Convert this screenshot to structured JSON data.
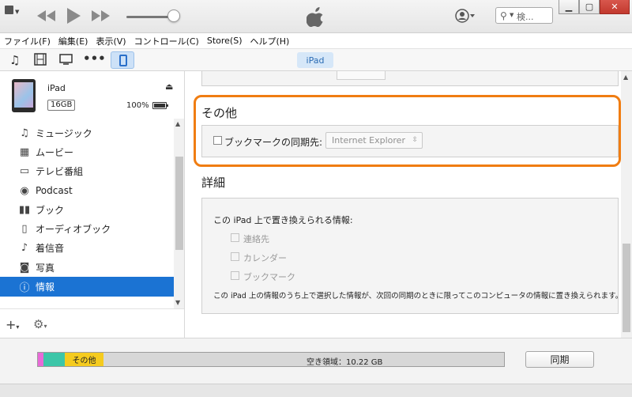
{
  "titlebar": {
    "search_placeholder": "検..."
  },
  "menubar": {
    "items": [
      "ファイル(F)",
      "編集(E)",
      "表示(V)",
      "コントロール(C)",
      "Store(S)",
      "ヘルプ(H)"
    ]
  },
  "toolbar": {
    "device_label": "iPad"
  },
  "device": {
    "name": "iPad",
    "capacity": "16GB",
    "battery": "100%"
  },
  "sidebar": {
    "items": [
      {
        "label": "ミュージック",
        "icon": "music-note-icon"
      },
      {
        "label": "ムービー",
        "icon": "film-icon"
      },
      {
        "label": "テレビ番組",
        "icon": "tv-icon"
      },
      {
        "label": "Podcast",
        "icon": "podcast-icon"
      },
      {
        "label": "ブック",
        "icon": "book-icon"
      },
      {
        "label": "オーディオブック",
        "icon": "audiobook-icon"
      },
      {
        "label": "着信音",
        "icon": "bell-icon"
      },
      {
        "label": "写真",
        "icon": "camera-icon"
      },
      {
        "label": "情報",
        "icon": "info-icon",
        "selected": true
      }
    ]
  },
  "main": {
    "other_title": "その他",
    "bookmark_label": "ブックマークの同期先:",
    "bookmark_target": "Internet Explorer",
    "detail_title": "詳細",
    "detail_heading": "この iPad 上で置き換えられる情報:",
    "detail_options": [
      "連絡先",
      "カレンダー",
      "ブックマーク"
    ],
    "detail_note": "この iPad 上の情報のうち上で選択した情報が、次回の同期のときに限ってこのコンピュータの情報に置き換えられます。"
  },
  "status": {
    "other_label": "その他",
    "free_label": "空き領域：10.22 GB",
    "sync_button": "同期",
    "segment_colors": [
      "#e86ad7",
      "#3cc6a8",
      "#f5cb1e"
    ]
  },
  "colors": {
    "accent": "#1b73d3",
    "highlight": "#f07d12"
  }
}
